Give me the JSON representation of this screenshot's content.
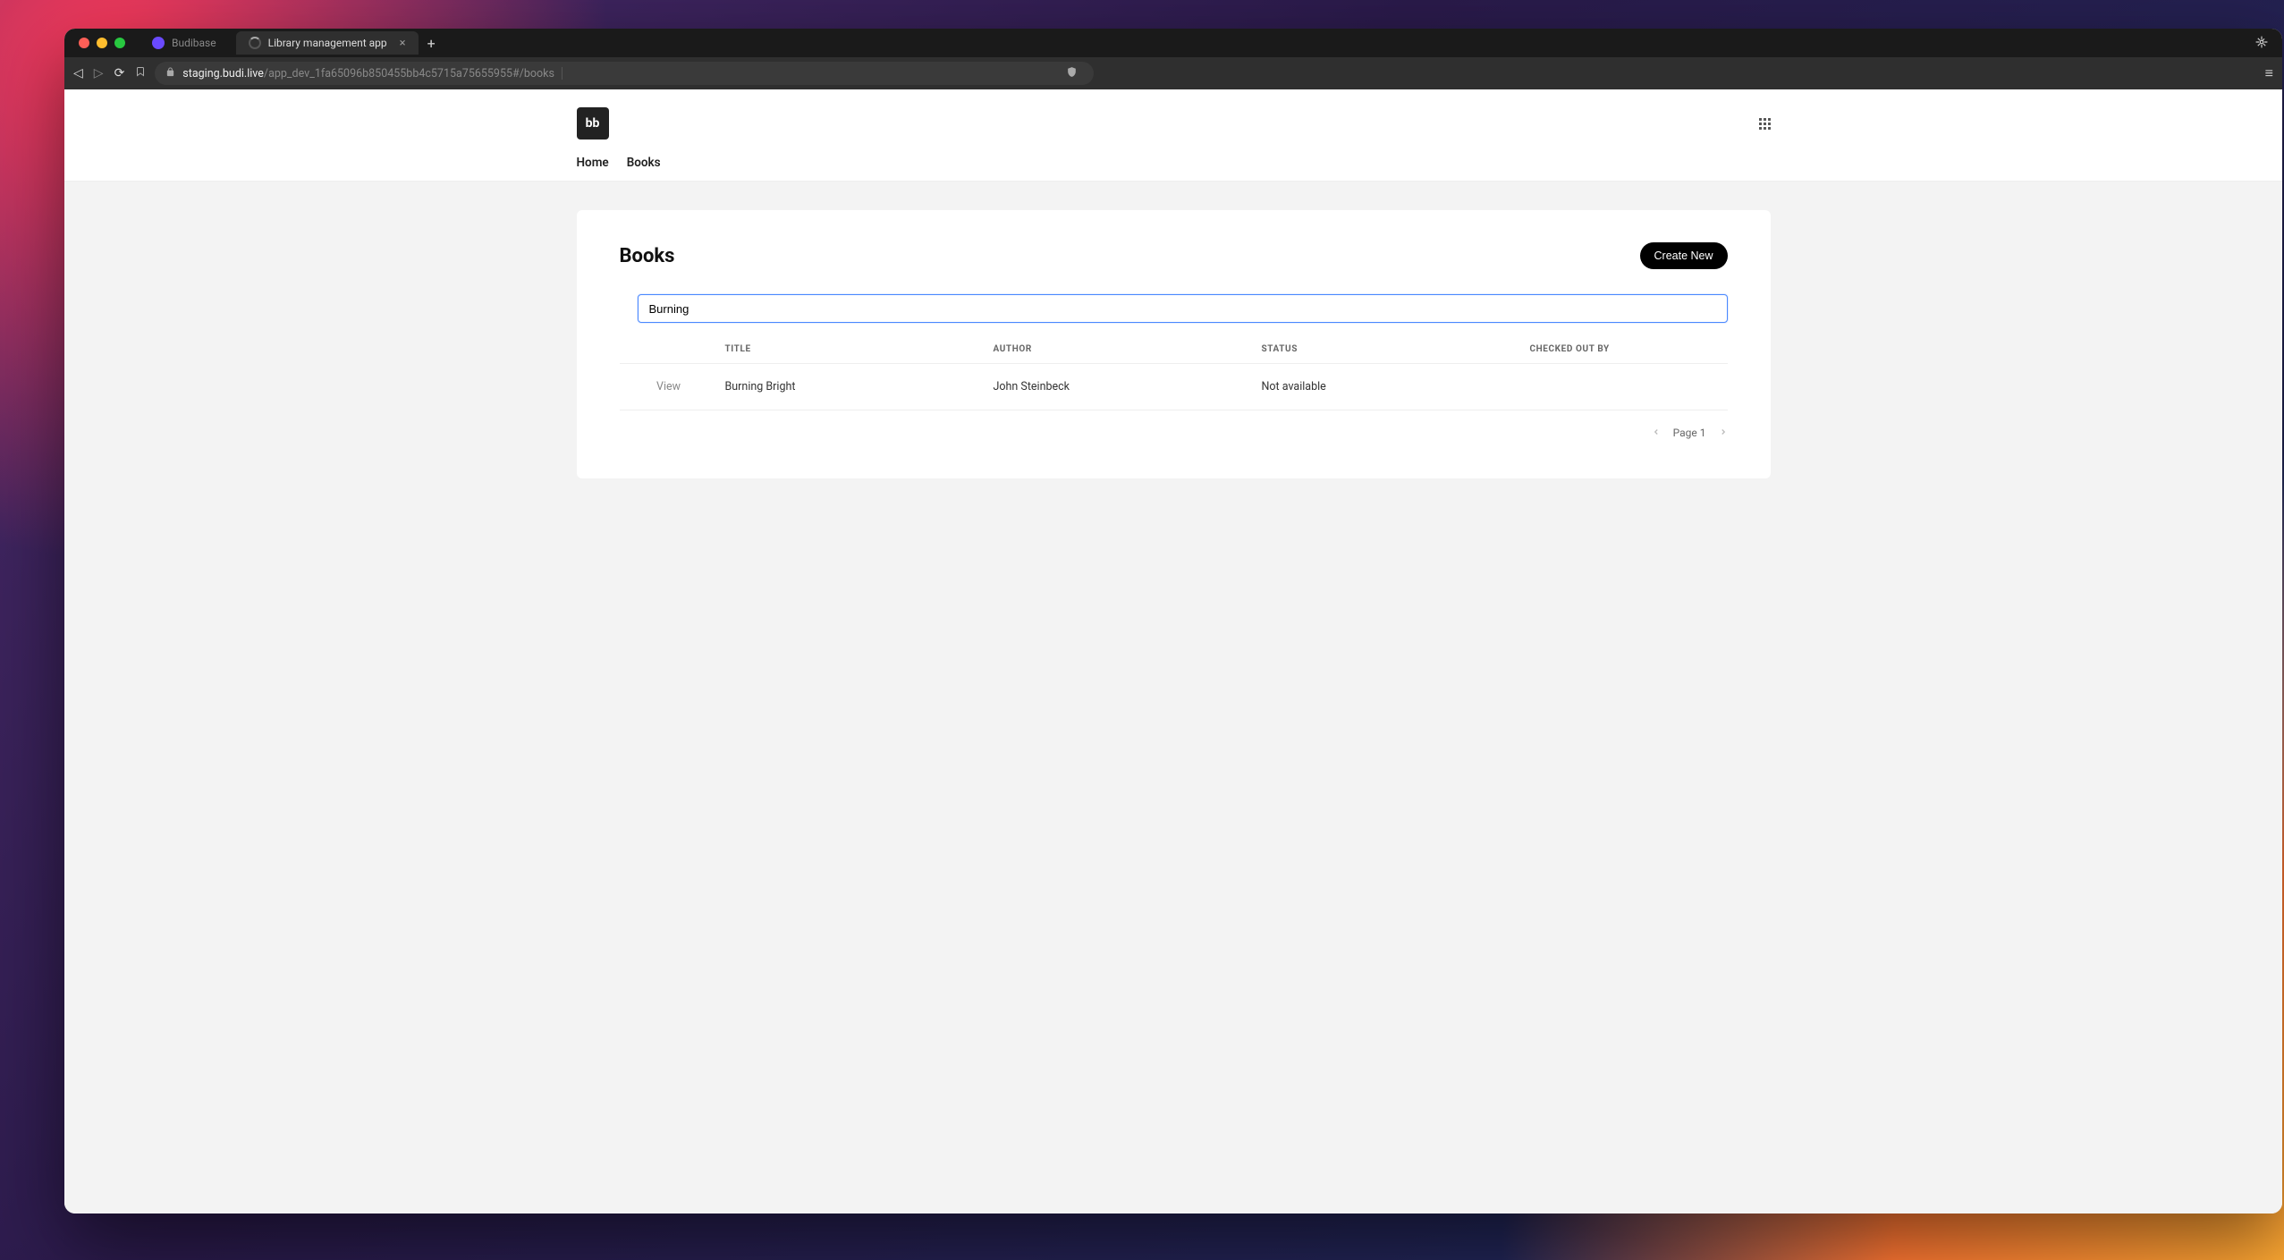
{
  "browser": {
    "tabs": [
      {
        "title": "Budibase",
        "active": false
      },
      {
        "title": "Library management app",
        "active": true
      }
    ],
    "url_host": "staging.budi.live",
    "url_path": "/app_dev_1fa65096b850455bb4c5715a75655955#/books"
  },
  "app": {
    "logo_text": "bb",
    "nav": {
      "home": "Home",
      "books": "Books"
    }
  },
  "page": {
    "title": "Books",
    "create_button": "Create New",
    "search_value": "Burning"
  },
  "table": {
    "columns": {
      "action": "",
      "title": "TITLE",
      "author": "AUTHOR",
      "status": "STATUS",
      "checked_out_by": "CHECKED OUT BY"
    },
    "rows": [
      {
        "action": "View",
        "title": "Burning Bright",
        "author": "John Steinbeck",
        "status": "Not available",
        "checked_out_by": ""
      }
    ],
    "pagination_label": "Page 1"
  }
}
